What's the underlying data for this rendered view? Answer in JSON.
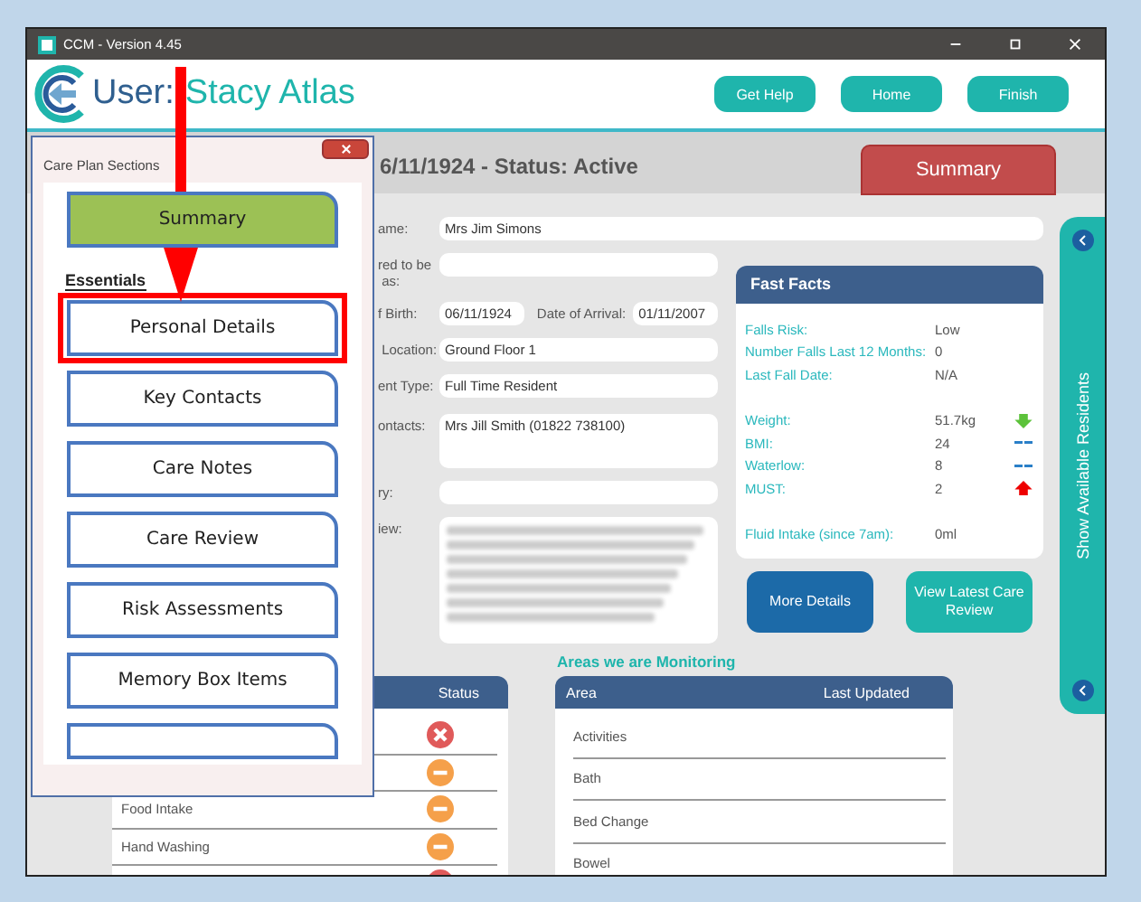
{
  "window": {
    "title": "CCM - Version 4.45"
  },
  "header": {
    "user_label": "User:",
    "user_name": "Stacy Atlas",
    "buttons": [
      "Get Help",
      "Home",
      "Finish"
    ]
  },
  "resident_status": "6/11/1924 - Status: Active",
  "summary_button": "Summary",
  "form": {
    "name": {
      "label": "ame:",
      "value": "Mrs Jim Simons"
    },
    "fields": [
      {
        "kind": "single",
        "label": "red to be\n as:"
      },
      {
        "kind": "birth",
        "label": "f Birth:",
        "value": "06/11/1924",
        "second_label": "Date of Arrival:",
        "second_value": "01/11/2007"
      },
      {
        "kind": "single",
        "label": " Location:",
        "value": "Ground Floor 1"
      },
      {
        "kind": "single",
        "label": "ent Type:",
        "value": "Full Time Resident"
      },
      {
        "kind": "tall",
        "label": "ontacts:",
        "value": "Mrs Jill Smith (01822 738100)"
      },
      {
        "kind": "single",
        "label": "ry:"
      },
      {
        "kind": "blurred",
        "label": "iew:"
      }
    ]
  },
  "fast_facts": {
    "title": "Fast Facts",
    "rows": [
      {
        "kind": "plain",
        "label": "Falls Risk:",
        "value": "Low"
      },
      {
        "kind": "plain",
        "label": "Number Falls Last 12 Months:",
        "value": "0"
      },
      {
        "kind": "plain",
        "label": "Last Fall Date:",
        "value": "N/A",
        "gap_after": true
      },
      {
        "kind": "down",
        "label": "Weight:",
        "value": "51.7kg"
      },
      {
        "kind": "flat",
        "label": "BMI:",
        "value": "24"
      },
      {
        "kind": "flat",
        "label": "Waterlow:",
        "value": "8"
      },
      {
        "kind": "up",
        "label": "MUST:",
        "value": "2",
        "gap_after": true
      },
      {
        "kind": "plain",
        "label": "Fluid Intake (since 7am):",
        "value": "0ml"
      }
    ]
  },
  "action_buttons": [
    {
      "label": "More Details",
      "kind": "primary"
    },
    {
      "label": "View Latest Care Review",
      "kind": "secondary"
    }
  ],
  "areas_title": "Areas we are Monitoring",
  "status_table": {
    "columns": [
      "Status"
    ],
    "rows": [
      {
        "kind": "cross"
      },
      {
        "kind": "minus"
      },
      {
        "kind": "minus",
        "name": "Food Intake"
      },
      {
        "kind": "minus",
        "name": "Hand Washing"
      },
      {
        "kind": "cross"
      }
    ]
  },
  "areas_table": {
    "columns": [
      "Area",
      "Last Updated"
    ],
    "rows": [
      {
        "area": "Activities"
      },
      {
        "area": "Bath"
      },
      {
        "area": "Bed Change"
      },
      {
        "area": "Bowel"
      }
    ]
  },
  "side_panel": {
    "label": "Show Available Residents"
  },
  "popup": {
    "title": "Care Plan Sections",
    "items": [
      {
        "kind": "summary",
        "label": "Summary",
        "highlighted": false
      },
      {
        "kind": "heading",
        "label": "Essentials"
      },
      {
        "kind": "section",
        "label": "Personal Details",
        "highlighted": true
      },
      {
        "kind": "section",
        "label": "Key Contacts",
        "highlighted": false
      },
      {
        "kind": "section",
        "label": "Care Notes",
        "highlighted": false
      },
      {
        "kind": "section",
        "label": "Care Review",
        "highlighted": false
      },
      {
        "kind": "section",
        "label": "Risk Assessments",
        "highlighted": false
      },
      {
        "kind": "section",
        "label": "Memory Box Items",
        "highlighted": false
      },
      {
        "kind": "partial",
        "highlighted": false
      }
    ]
  }
}
